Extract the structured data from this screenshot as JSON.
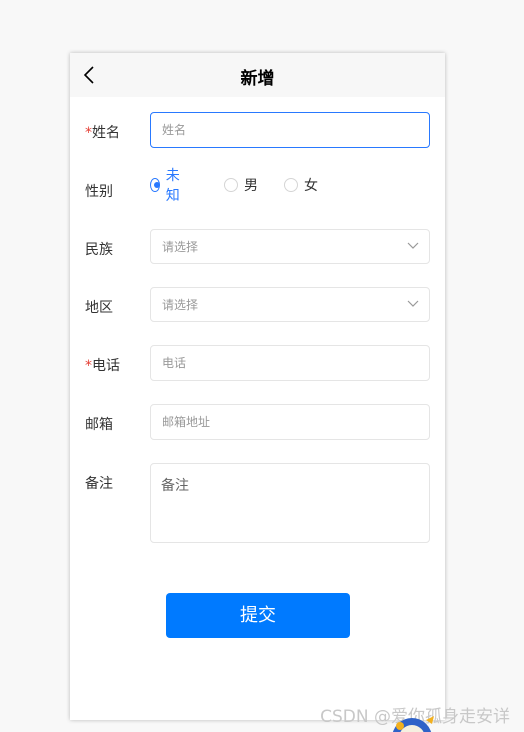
{
  "header": {
    "title": "新增"
  },
  "form": {
    "name": {
      "required_mark": "*",
      "label": "姓名",
      "placeholder": "姓名"
    },
    "gender": {
      "label": "性别",
      "options": [
        {
          "label": "未知",
          "selected": true
        },
        {
          "label": "男",
          "selected": false
        },
        {
          "label": "女",
          "selected": false
        }
      ]
    },
    "ethnicity": {
      "label": "民族",
      "placeholder": "请选择"
    },
    "region": {
      "label": "地区",
      "placeholder": "请选择"
    },
    "phone": {
      "required_mark": "*",
      "label": "电话",
      "placeholder": "电话"
    },
    "email": {
      "label": "邮箱",
      "placeholder": "邮箱地址"
    },
    "remark": {
      "label": "备注",
      "placeholder": "备注"
    }
  },
  "submit_label": "提交",
  "watermark": "CSDN @爱你孤身走安详",
  "colors": {
    "accent": "#2979ff",
    "button": "#007aff",
    "required": "#e43d33"
  },
  "icons": {
    "back": "chevron-left-icon",
    "dropdown": "chevron-down-icon"
  }
}
